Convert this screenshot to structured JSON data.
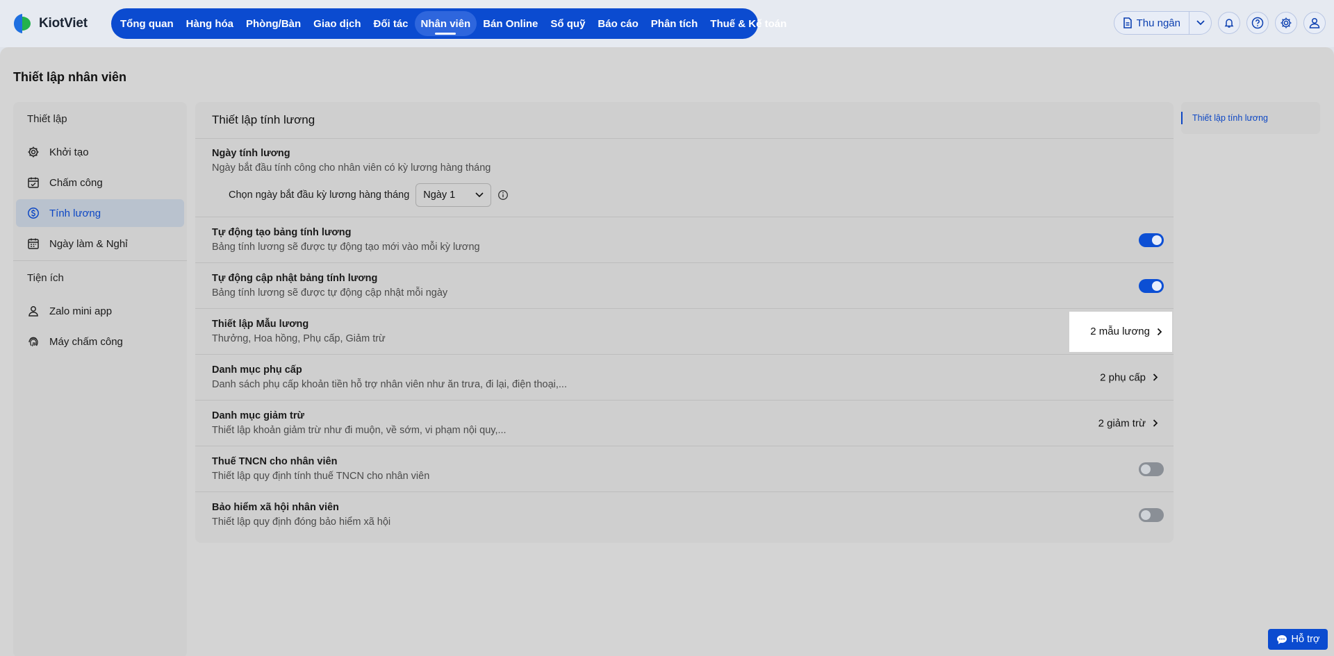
{
  "app": {
    "logo_text": "KiotViet"
  },
  "colors": {
    "brand": "#0b4bd0",
    "active_text": "#0d47c4",
    "toggle_on": "#0c4fd4",
    "toggle_off": "#8a8f96"
  },
  "nav": {
    "items": [
      {
        "label": "Tổng quan"
      },
      {
        "label": "Hàng hóa"
      },
      {
        "label": "Phòng/Bàn"
      },
      {
        "label": "Giao dịch"
      },
      {
        "label": "Đối tác"
      },
      {
        "label": "Nhân viên",
        "active": true
      },
      {
        "label": "Bán Online"
      },
      {
        "label": "Sổ quỹ"
      },
      {
        "label": "Báo cáo"
      },
      {
        "label": "Phân tích"
      },
      {
        "label": "Thuế & Kế toán"
      }
    ]
  },
  "toolbar": {
    "cashier_label": "Thu ngân",
    "icons": [
      "document-icon",
      "chevron-down-icon",
      "bell-icon",
      "help-icon",
      "gear-icon",
      "user-icon"
    ]
  },
  "page": {
    "title": "Thiết lập nhân viên"
  },
  "sidebar": {
    "section1": "Thiết lập",
    "items1": [
      {
        "label": "Khởi tạo",
        "icon": "gear-icon"
      },
      {
        "label": "Chấm công",
        "icon": "calendar-check-icon"
      },
      {
        "label": "Tính lương",
        "icon": "dollar-circle-icon",
        "active": true
      },
      {
        "label": "Ngày làm & Nghỉ",
        "icon": "calendar-icon"
      }
    ],
    "section2": "Tiện ích",
    "items2": [
      {
        "label": "Zalo mini app",
        "icon": "person-icon"
      },
      {
        "label": "Máy chấm công",
        "icon": "fingerprint-icon"
      }
    ]
  },
  "panel": {
    "title": "Thiết lập tính lương",
    "rows": [
      {
        "title": "Ngày tính lương",
        "desc": "Ngày bắt đầu tính công cho nhân viên có kỳ lương hàng tháng",
        "select_label": "Chọn ngày bắt đầu kỳ lương hàng tháng",
        "select_value": "Ngày 1"
      },
      {
        "title": "Tự động tạo bảng tính lương",
        "desc": "Bảng tính lương sẽ được tự động tạo mới vào mỗi kỳ lương",
        "toggle": "on"
      },
      {
        "title": "Tự động cập nhật bảng tính lương",
        "desc": "Bảng tính lương sẽ được tự động cập nhật mỗi ngày",
        "toggle": "on"
      },
      {
        "title": "Thiết lập Mẫu lương",
        "desc": "Thưởng, Hoa hồng, Phụ cấp, Giảm trừ",
        "link": "2 mẫu lương"
      },
      {
        "title": "Danh mục phụ cấp",
        "desc": "Danh sách phụ cấp khoản tiền hỗ trợ nhân viên như ăn trưa, đi lại, điện thoại,...",
        "link": "2 phụ cấp"
      },
      {
        "title": "Danh mục giảm trừ",
        "desc": "Thiết lập khoản giảm trừ như đi muộn, về sớm, vi phạm nội quy,...",
        "link": "2 giảm trừ"
      },
      {
        "title": "Thuế TNCN cho nhân viên",
        "desc": "Thiết lập quy định tính thuế TNCN cho nhân viên",
        "toggle": "off"
      },
      {
        "title": "Bảo hiểm xã hội nhân viên",
        "desc": "Thiết lập quy định đóng bảo hiểm xã hội",
        "toggle": "off"
      }
    ]
  },
  "rightnav": {
    "item": "Thiết lập tính lương"
  },
  "support": {
    "label": "Hỗ trợ"
  }
}
